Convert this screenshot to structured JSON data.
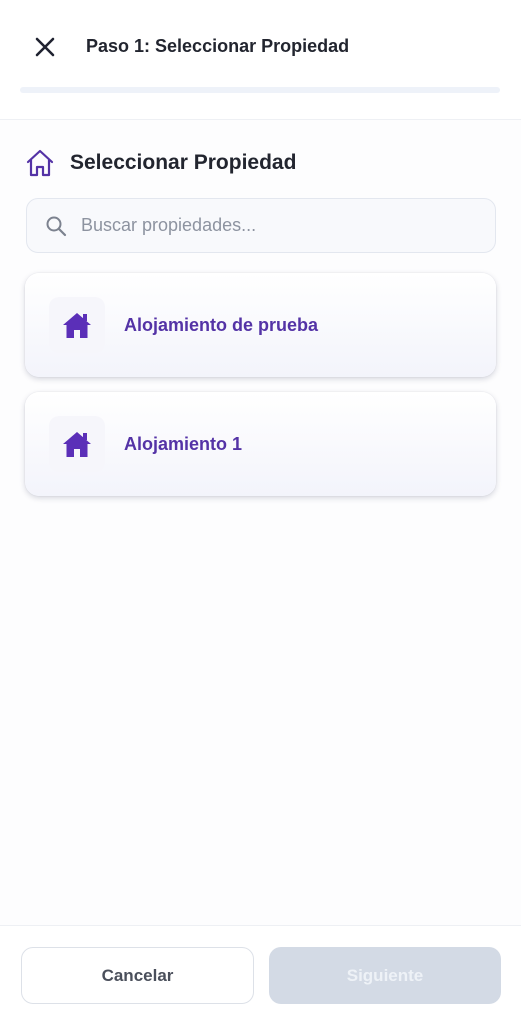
{
  "header": {
    "title": "Paso 1: Seleccionar Propiedad",
    "close_icon": "close-icon"
  },
  "progress": {
    "step": 1,
    "fraction": 0.0
  },
  "section": {
    "title": "Seleccionar Propiedad",
    "icon": "home-outline-icon"
  },
  "search": {
    "placeholder": "Buscar propiedades...",
    "value": "",
    "icon": "search-icon"
  },
  "properties": [
    {
      "name": "Alojamiento de prueba",
      "icon": "home-icon"
    },
    {
      "name": "Alojamiento 1",
      "icon": "home-icon"
    }
  ],
  "footer": {
    "cancel_label": "Cancelar",
    "next_label": "Siguiente"
  },
  "colors": {
    "accent": "#5433a6",
    "icon_purple": "#5b2fb8",
    "next_disabled_bg": "#d3dae5",
    "text_dark": "#22252f"
  }
}
